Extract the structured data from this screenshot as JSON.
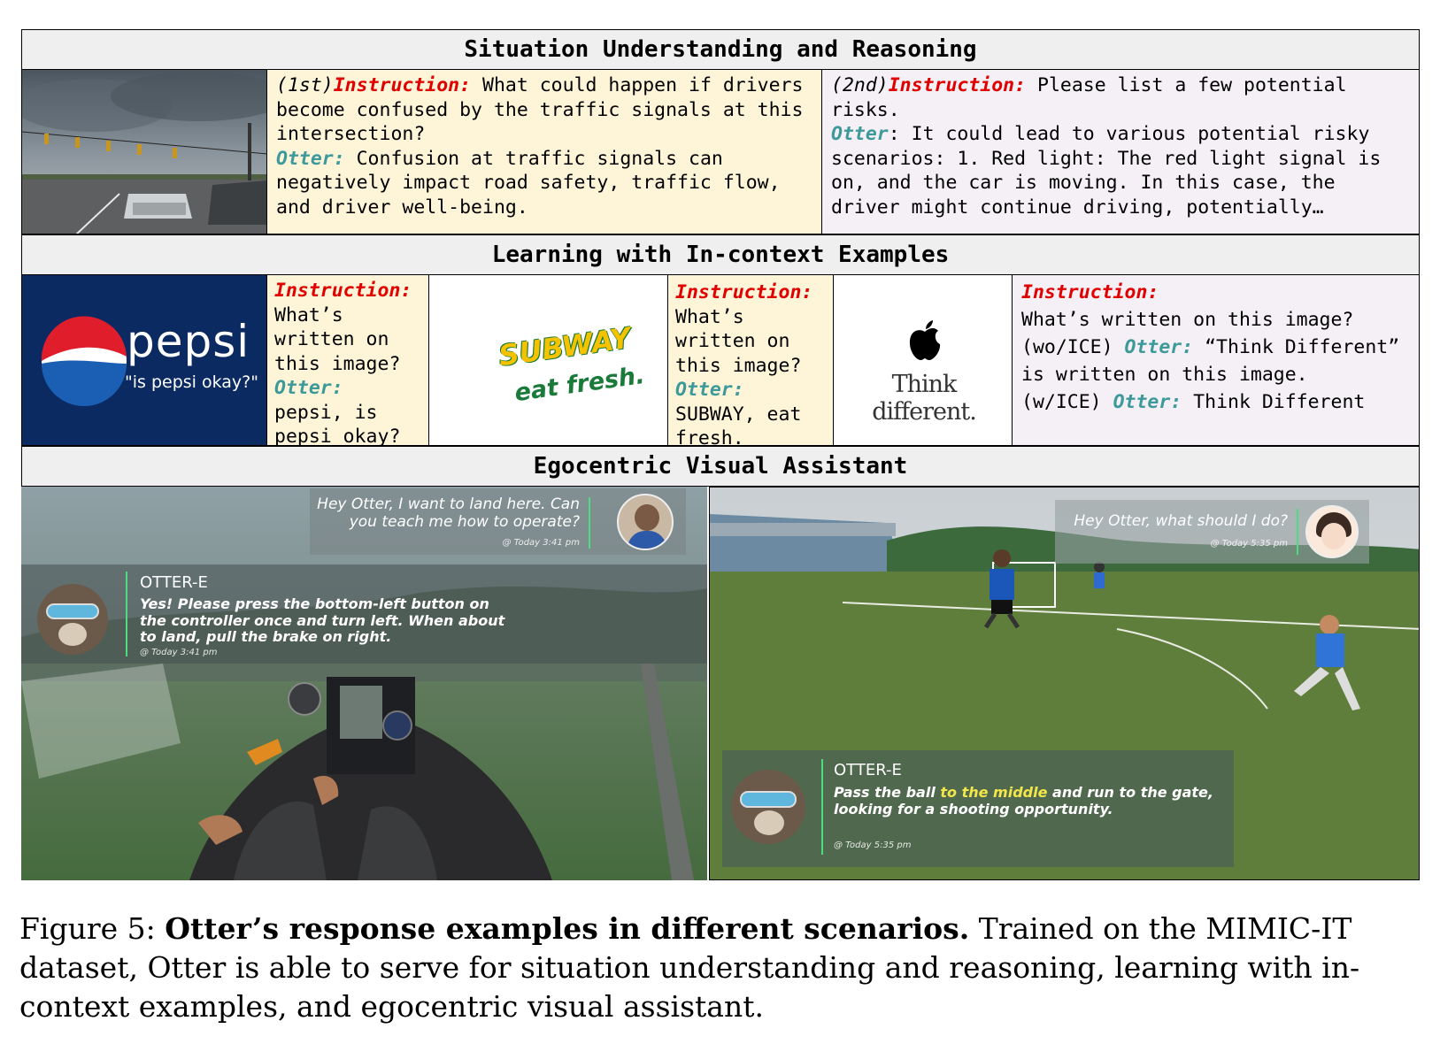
{
  "sections": {
    "s1_title": "Situation Understanding and Reasoning",
    "s2_title": "Learning with In-context Examples",
    "s3_title": "Egocentric Visual Assistant"
  },
  "s1": {
    "c1": {
      "prefix": "(1st)",
      "instr_label": "Instruction:",
      "instr_text": " What could happen if drivers become confused by the traffic signals at this intersection?",
      "otter_label": "Otter:",
      "otter_text": " Confusion at traffic signals can negatively impact road safety, traffic flow, and driver well-being."
    },
    "c2": {
      "prefix": "(2nd)",
      "instr_label": "Instruction:",
      "instr_text": " Please list a few potential risks.",
      "otter_label": "Otter",
      "otter_text": ": It could lead to various potential risky scenarios: 1. Red light: The red light signal is on, and the car is moving. In this case, the driver might continue driving, potentially…"
    }
  },
  "s2": {
    "pepsi": {
      "brand": "pepsi",
      "tagline": "\"is pepsi okay?\""
    },
    "ex1": {
      "instr_label": "Instruction:",
      "instr_text": "What’s written on this image?",
      "otter_label": "Otter:",
      "otter_text": " pepsi, is pepsi okay?"
    },
    "subway": {
      "brand": "SUBWAY",
      "tagline": "eat fresh."
    },
    "ex2": {
      "instr_label": "Instruction:",
      "instr_text": "What’s written on this image?",
      "otter_label": "Otter:",
      "otter_text": " SUBWAY, eat fresh."
    },
    "apple": {
      "logo_glyph": "",
      "tagline": "Think different."
    },
    "ex3": {
      "instr_label": "Instruction:",
      "line1": "What’s written on this image?",
      "woice_prefix": "(wo/ICE) ",
      "otter_label1": "Otter:",
      "woice_text": " “Think Different” is written on this image.",
      "wice_prefix": "(w/ICE) ",
      "otter_label2": "Otter:",
      "wice_text": " Think Different"
    }
  },
  "s3": {
    "left": {
      "user_msg": "Hey Otter, I want to land here. Can you teach me how to operate?",
      "user_time": "@ Today 3:41 pm",
      "bot_name": "OTTER-E",
      "bot_msg": "Yes! Please press the bottom-left button on the controller once and turn left. When about to land, pull the brake on right.",
      "bot_time": "@ Today 3:41 pm"
    },
    "right": {
      "user_msg": "Hey Otter, what should I do?",
      "user_time": "@ Today 5:35 pm",
      "bot_name": "OTTER-E",
      "bot_msg_a": "Pass the ball ",
      "bot_msg_highlight": "to the middle",
      "bot_msg_b": " and run to the gate, looking for a shooting opportunity.",
      "bot_time": "@ Today 5:35 pm"
    }
  },
  "caption": {
    "label": "Figure 5: ",
    "bold": "Otter’s response examples in different scenarios.",
    "text": " Trained on the MIMIC-IT dataset, Otter is able to serve for situation understanding and reasoning, learning with in-context examples, and egocentric visual assistant."
  },
  "colors": {
    "instruction": "#e00000",
    "otter": "#3e9a9a",
    "yellow_cell": "#fef5d8",
    "lilac_cell": "#f4f0f5",
    "header_bg": "#efefef",
    "highlight": "#f2e64a"
  }
}
